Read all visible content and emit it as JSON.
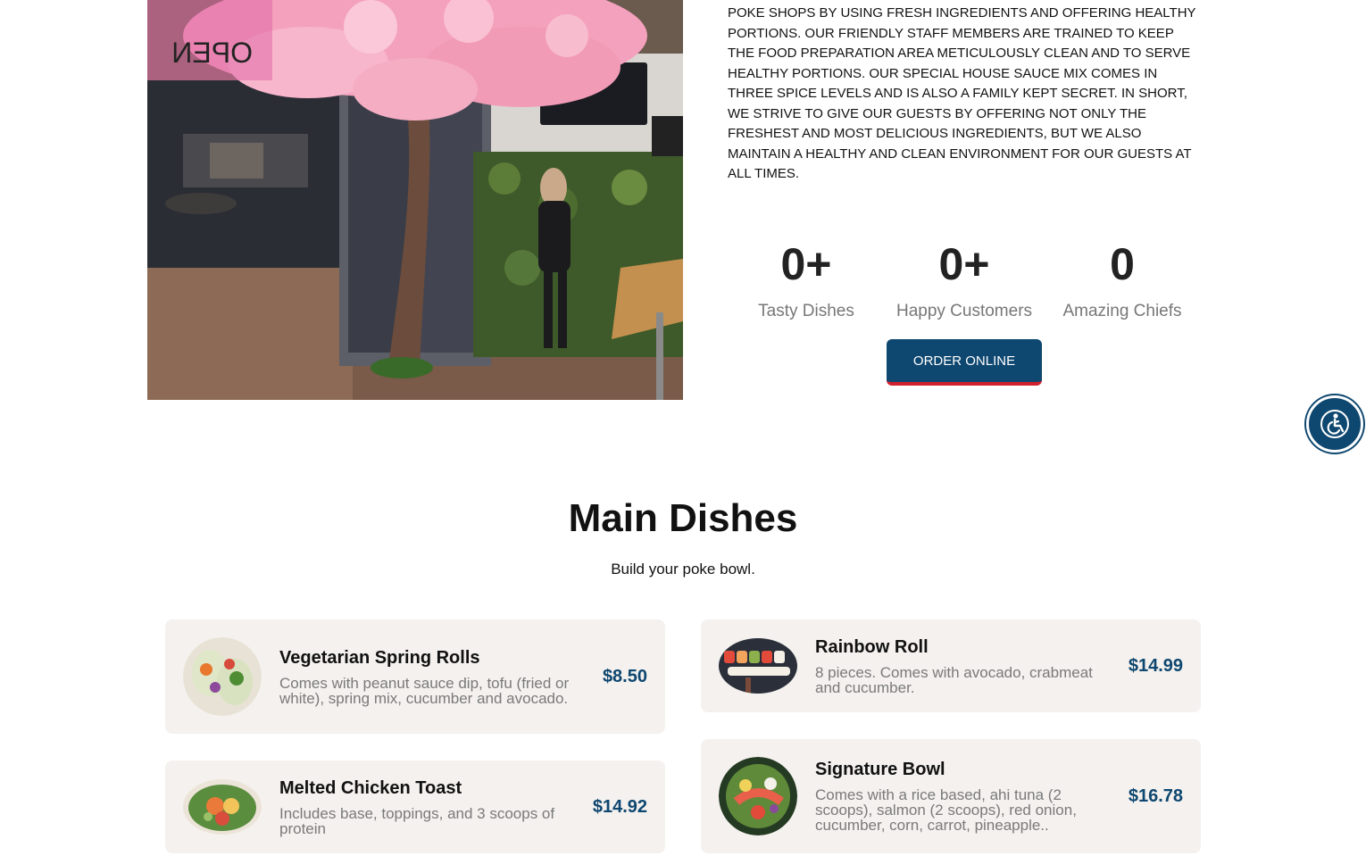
{
  "about": {
    "text": "Poke shops by using fresh ingredients and offering healthy portions. Our friendly staff members are trained to keep the food preparation area meticulously clean and to serve healthy portions. Our special house sauce mix comes in three spice levels and is also a family kept secret. In short, we strive to give our guests by offering not only the freshest and most delicious ingredients, but we also maintain a healthy and clean environment for our guests at all times."
  },
  "hero": {
    "sign_text": "OPEN"
  },
  "stats": [
    {
      "value": "0+",
      "label": "Tasty Dishes"
    },
    {
      "value": "0+",
      "label": "Happy Customers"
    },
    {
      "value": "0",
      "label": "Amazing Chiefs"
    }
  ],
  "order_button": {
    "label": "ORDER ONLINE"
  },
  "colors": {
    "primary": "#0e4770",
    "accent_red": "#d0202e",
    "card_bg": "#f4f1ee"
  },
  "accessibility": {
    "icon": "accessibility-icon"
  },
  "main_dishes": {
    "title": "Main Dishes",
    "subtitle": "Build your poke bowl.",
    "items": [
      {
        "name": "Vegetarian Spring Rolls",
        "desc": "Comes with peanut sauce dip, tofu (fried or white), spring mix, cucumber and avocado.",
        "price": "$8.50"
      },
      {
        "name": "Rainbow Roll",
        "desc": "8 pieces. Comes with avocado, crabmeat and cucumber.",
        "price": "$14.99"
      },
      {
        "name": "Melted Chicken Toast",
        "desc": "Includes base, toppings, and 3 scoops of protein",
        "price": "$14.92"
      },
      {
        "name": "Signature Bowl",
        "desc": "Comes with a rice based, ahi tuna (2 scoops), salmon (2 scoops), red onion, cucumber, corn, carrot, pineapple..",
        "price": "$16.78"
      }
    ]
  }
}
